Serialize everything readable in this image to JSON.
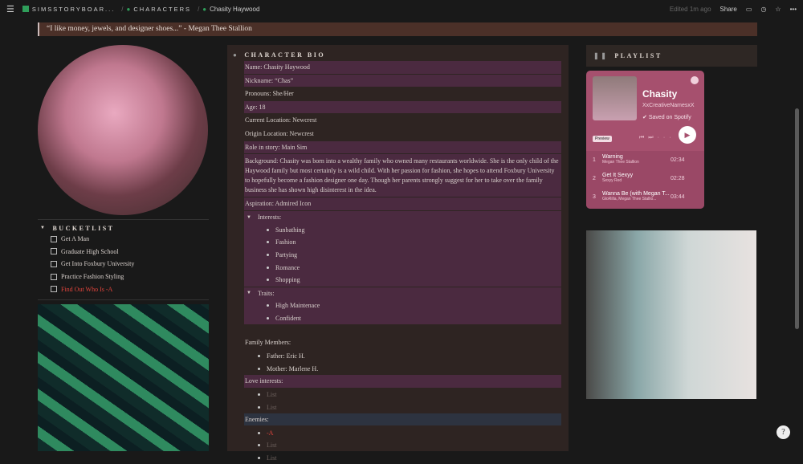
{
  "breadcrumb": {
    "workspace": "SIMSSTORYBOAR...",
    "section": "CHARACTERS",
    "page": "Chasity Haywood"
  },
  "topbar": {
    "edited": "Edited 1m ago",
    "share": "Share"
  },
  "quote": "“I like money, jewels, and designer shoes...” - Megan Thee Stallion",
  "bucketlist": {
    "title": "BUCKETLIST",
    "items": [
      {
        "label": "Get A Man",
        "highlight": false
      },
      {
        "label": "Graduate High School",
        "highlight": false
      },
      {
        "label": "Get Into Foxbury University",
        "highlight": false
      },
      {
        "label": "Practice Fashion Styling",
        "highlight": false
      },
      {
        "label": "Find Out Who Is -A",
        "highlight": true
      }
    ]
  },
  "bio": {
    "title": "CHARACTER BIO",
    "name": "Name: Chasity Haywood",
    "nickname": "Nickname: “Chas”",
    "pronouns": "Pronouns: She/Her",
    "age": "Age: 18",
    "current": "Current Location: Newcrest",
    "origin": "Origin Location: Newcrest",
    "role": "Role in story: Main Sim",
    "background": "Background: Chasity was born into a wealthy family who owned many restaurants worldwide. She is the only child of the Haywood family but most certainly is a wild child. With her passion for fashion, she hopes to attend Foxbury University to hopefully become a fashion designer one day. Though her parents strongly suggest for her to take over the family business she has shown high disinterest in the idea.",
    "aspiration": "Aspiration: Admired Icon",
    "interests_label": "Interests:",
    "interests": [
      "Sunbathing",
      "Fashion",
      "Partying",
      "Romance",
      "Shopping"
    ],
    "traits_label": "Traits:",
    "traits": [
      "High Maintenace",
      "Confident"
    ],
    "family_label": "Family Members:",
    "family": [
      "Father: Eric H.",
      "Mother: Marlene H."
    ],
    "love_label": "Love interests:",
    "love": [
      "List",
      "List"
    ],
    "enemies_label": "Enemies:",
    "enemies": [
      "-A",
      "List",
      "List"
    ]
  },
  "playlist": {
    "title": "PLAYLIST",
    "name": "Chasity",
    "owner": "XxCreativeNamesxX",
    "saved": "Saved on Spotify",
    "preview": "Preview",
    "tracks": [
      {
        "n": "1",
        "title": "Warning",
        "artist": "Megan Thee Stallion",
        "dur": "02:34"
      },
      {
        "n": "2",
        "title": "Get It Sexyy",
        "artist": "Sexyy Red",
        "dur": "02:28"
      },
      {
        "n": "3",
        "title": "Wanna Be (with Megan T...",
        "artist": "GloRilla, Megan Thee Stallio...",
        "dur": "03:44"
      }
    ]
  },
  "colors": {
    "purple_row": "#4b2a40",
    "blue_row": "#2d3340",
    "quote_bg": "#4b3028",
    "accent_red": "#e0443c"
  }
}
